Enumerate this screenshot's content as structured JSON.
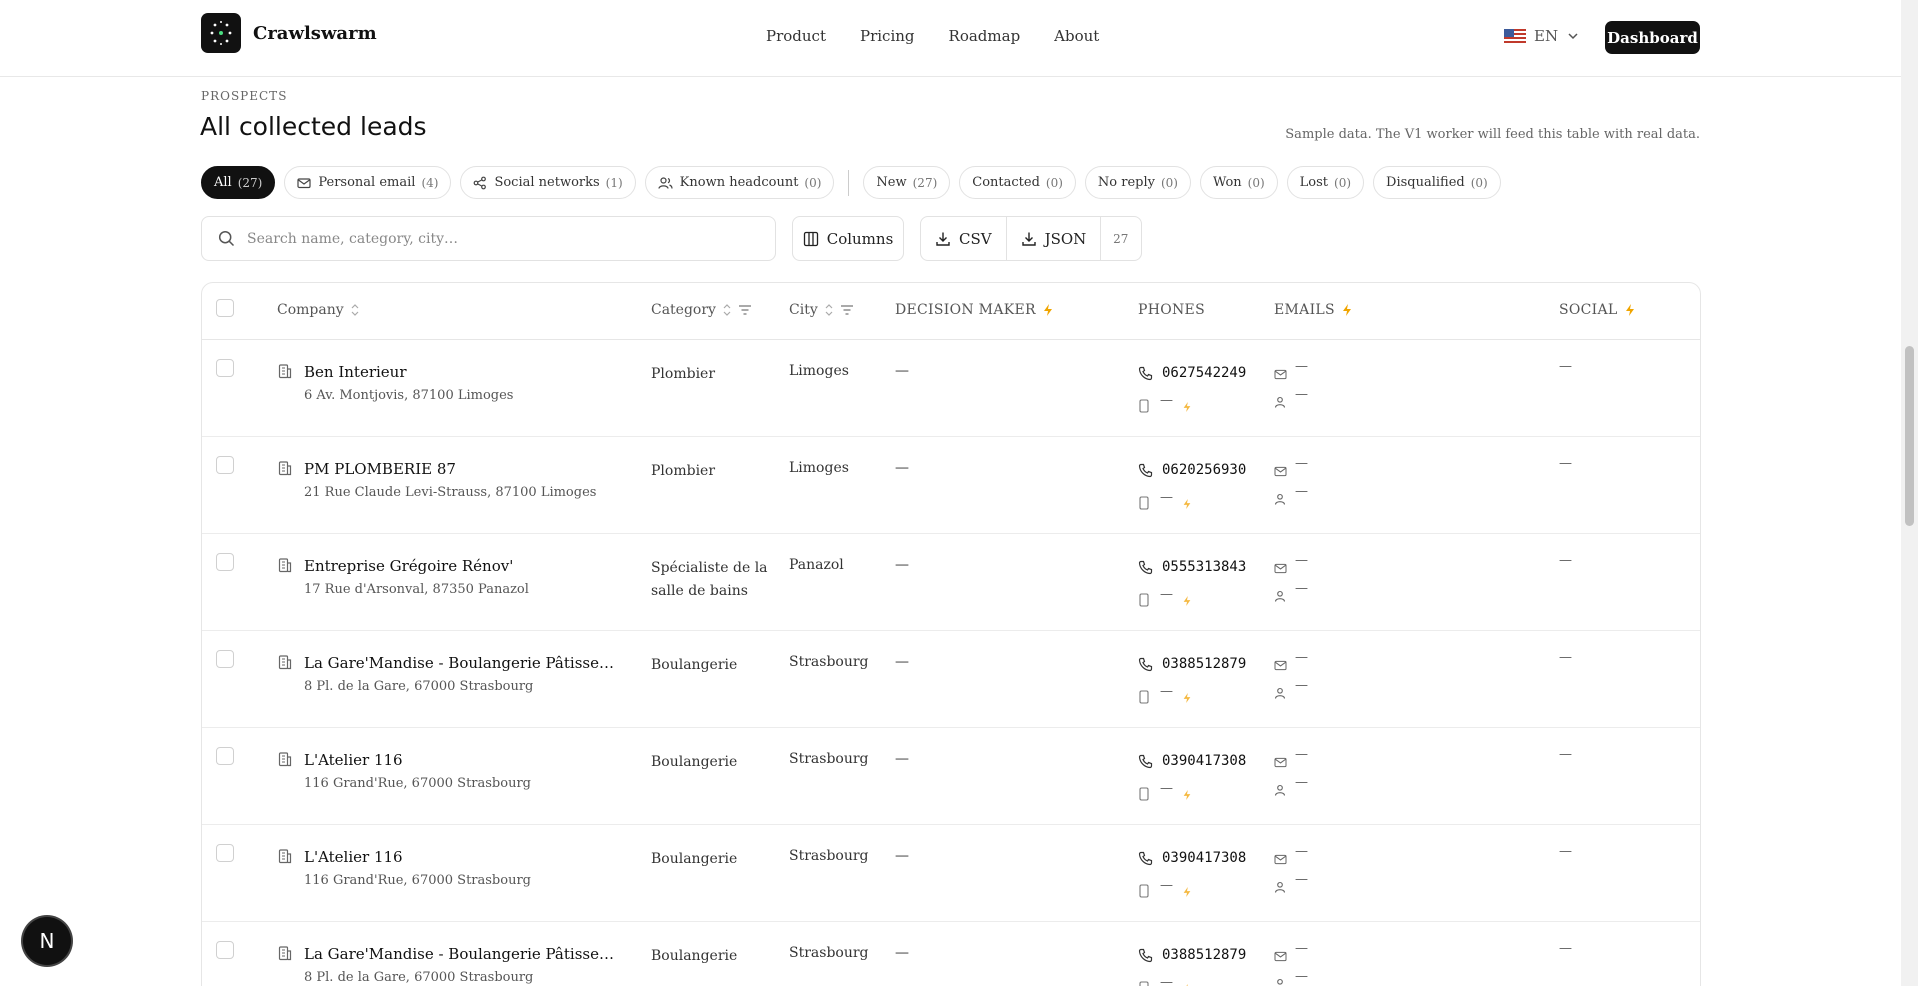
{
  "header": {
    "brand": "Crawlswarm",
    "nav": [
      "Product",
      "Pricing",
      "Roadmap",
      "About"
    ],
    "language": "EN",
    "dashboard_label": "Dashboard"
  },
  "page": {
    "eyebrow": "PROSPECTS",
    "title": "All collected leads",
    "note": "Sample data. The V1 worker will feed this table with real data."
  },
  "filters": [
    {
      "label": "All",
      "count": "(27)",
      "icon": "none",
      "active": true
    },
    {
      "label": "Personal email",
      "count": "(4)",
      "icon": "mail-icon"
    },
    {
      "label": "Social networks",
      "count": "(1)",
      "icon": "share-icon"
    },
    {
      "label": "Known headcount",
      "count": "(0)",
      "icon": "users-icon"
    },
    {
      "label": "New",
      "count": "(27)",
      "icon": "none"
    },
    {
      "label": "Contacted",
      "count": "(0)",
      "icon": "none"
    },
    {
      "label": "No reply",
      "count": "(0)",
      "icon": "none"
    },
    {
      "label": "Won",
      "count": "(0)",
      "icon": "none"
    },
    {
      "label": "Lost",
      "count": "(0)",
      "icon": "none"
    },
    {
      "label": "Disqualified",
      "count": "(0)",
      "icon": "none"
    }
  ],
  "toolbar": {
    "search_placeholder": "Search name, category, city…",
    "columns_label": "Columns",
    "csv_label": "CSV",
    "json_label": "JSON",
    "count": "27"
  },
  "table": {
    "columns": {
      "company": "Company",
      "category": "Category",
      "city": "City",
      "decision_maker": "DECISION MAKER",
      "phones": "PHONES",
      "emails": "EMAILS",
      "social": "SOCIAL"
    },
    "empty": "—",
    "rows": [
      {
        "name": "Ben Interieur",
        "address": "6 Av. Montjovis, 87100 Limoges",
        "category": "Plombier",
        "city": "Limoges",
        "phone": "0627542249"
      },
      {
        "name": "PM PLOMBERIE 87",
        "address": "21 Rue Claude Levi-Strauss, 87100 Limoges",
        "category": "Plombier",
        "city": "Limoges",
        "phone": "0620256930"
      },
      {
        "name": "Entreprise Grégoire Rénov'",
        "address": "17 Rue d'Arsonval, 87350 Panazol",
        "category": "Spécialiste de la salle de bains",
        "city": "Panazol",
        "phone": "0555313843"
      },
      {
        "name": "La Gare'Mandise - Boulangerie Pâtisserie Salon de thé",
        "address": "8 Pl. de la Gare, 67000 Strasbourg",
        "category": "Boulangerie",
        "city": "Strasbourg",
        "phone": "0388512879"
      },
      {
        "name": "L'Atelier 116",
        "address": "116 Grand'Rue, 67000 Strasbourg",
        "category": "Boulangerie",
        "city": "Strasbourg",
        "phone": "0390417308"
      },
      {
        "name": "L'Atelier 116",
        "address": "116 Grand'Rue, 67000 Strasbourg",
        "category": "Boulangerie",
        "city": "Strasbourg",
        "phone": "0390417308"
      },
      {
        "name": "La Gare'Mandise - Boulangerie Pâtisserie Salon de thé",
        "address": "8 Pl. de la Gare, 67000 Strasbourg",
        "category": "Boulangerie",
        "city": "Strasbourg",
        "phone": "0388512879"
      }
    ]
  },
  "assist_badge": "N",
  "colors": {
    "accent_bolt": "#f0a500",
    "ink": "#111111"
  }
}
